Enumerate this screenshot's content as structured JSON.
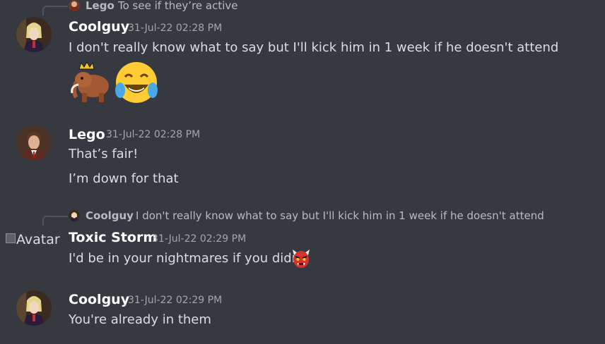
{
  "messages": [
    {
      "reply": {
        "author": "Lego",
        "text": "To see if they’re active",
        "avatar_icon": "lego-avatar-icon"
      },
      "author": "Coolguy",
      "timestamp": "31-Jul-22 02:28 PM",
      "lines": [
        "I don't really know what to say but I'll kick him in 1 week if he doesn't attend"
      ],
      "emojis": [
        "crowned-mammoth-emoji",
        "joy-emoji"
      ]
    },
    {
      "author": "Lego",
      "timestamp": "31-Jul-22 02:28 PM",
      "lines": [
        "That’s fair!",
        "I’m down for that"
      ]
    },
    {
      "reply": {
        "author": "Coolguy",
        "text": "I don't really know what to say but I'll kick him in 1 week if he doesn't attend",
        "avatar_icon": "coolguy-avatar-icon"
      },
      "avatar_alt": "Avatar",
      "author": "Toxic Storm",
      "timestamp": "31-Jul-22 02:29 PM",
      "lines": [
        "I'd be in your nightmares if you didn't"
      ],
      "emojis": [
        "japanese-ogre-emoji"
      ]
    },
    {
      "author": "Coolguy",
      "timestamp": "31-Jul-22 02:29 PM",
      "lines": [
        "You're already in them"
      ]
    }
  ],
  "colors": {
    "background": "#36393f",
    "text": "#dcddde",
    "username": "#ffffff",
    "muted": "#a3a6aa"
  }
}
